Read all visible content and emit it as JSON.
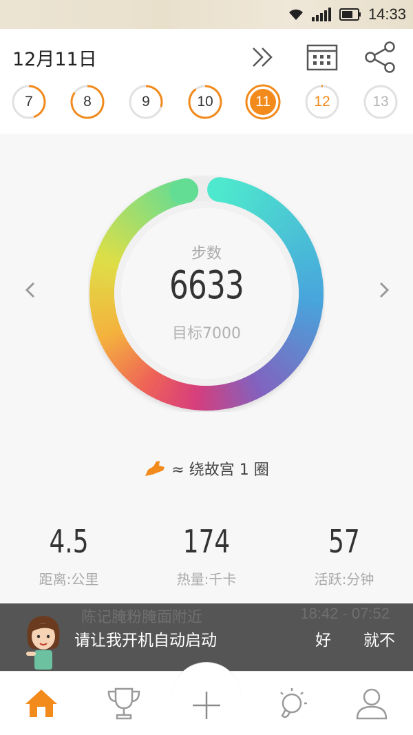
{
  "status_bar": {
    "time": "14:33"
  },
  "header": {
    "date": "12月11日",
    "icons": [
      "double-chevron-right-icon",
      "calendar-icon",
      "share-icon"
    ],
    "days": [
      {
        "label": "7",
        "state": "past",
        "progress": 0.45
      },
      {
        "label": "8",
        "state": "past",
        "progress": 0.85
      },
      {
        "label": "9",
        "state": "past",
        "progress": 0.3
      },
      {
        "label": "10",
        "state": "past",
        "progress": 0.9
      },
      {
        "label": "11",
        "state": "selected",
        "progress": 0.95
      },
      {
        "label": "12",
        "state": "future-near",
        "progress": 0.0
      },
      {
        "label": "13",
        "state": "future",
        "progress": 0.0
      }
    ]
  },
  "ring": {
    "label": "步数",
    "value": "6633",
    "goal": "目标7000",
    "progress": 0.948
  },
  "compare": {
    "text": "≈ 绕故宫 1 圈",
    "icon": "shoe-icon"
  },
  "stats": [
    {
      "value": "4.5",
      "label": "距离:公里"
    },
    {
      "value": "174",
      "label": "热量:千卡"
    },
    {
      "value": "57",
      "label": "活跃:分钟"
    }
  ],
  "behind_toast": {
    "location": "陈记腌粉腌面附近",
    "time": "18:42 - 07:52"
  },
  "toast": {
    "message": "请让我开机自动启动",
    "ok": "好",
    "cancel": "就不"
  },
  "nav": {
    "items": [
      "home-icon",
      "trophy-icon",
      "add-icon",
      "idea-bulb-icon",
      "profile-icon"
    ],
    "active": "home-icon"
  },
  "colors": {
    "accent": "#f28a1c",
    "inactive": "#a0a0a0",
    "toast_bg": "#555556"
  }
}
